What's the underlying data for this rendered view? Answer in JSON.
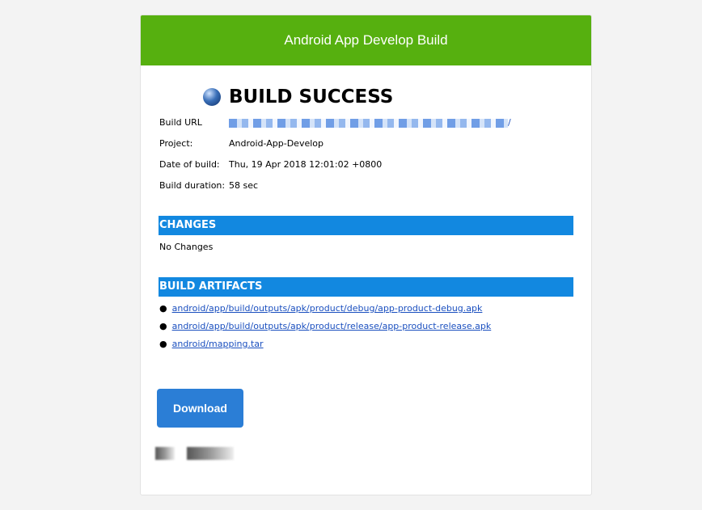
{
  "header": {
    "title": "Android App Develop Build"
  },
  "status": {
    "title": "BUILD SUCCESS",
    "icon": "blue-ball-icon"
  },
  "details": [
    {
      "label": "Build URL",
      "value": "",
      "link_suffix": "/"
    },
    {
      "label": "Project:",
      "value": "Android-App-Develop"
    },
    {
      "label": "Date of build:",
      "value": "Thu, 19 Apr 2018 12:01:02 +0800"
    },
    {
      "label": "Build duration:",
      "value": "58 sec"
    }
  ],
  "changes": {
    "heading": "CHANGES",
    "text": "No Changes"
  },
  "artifacts": {
    "heading": "BUILD ARTIFACTS",
    "items": [
      "android/app/build/outputs/apk/product/debug/app-product-debug.apk",
      "android/app/build/outputs/apk/product/release/app-product-release.apk",
      "android/mapping.tar"
    ]
  },
  "download_label": "Download",
  "colors": {
    "header": "#56b00f",
    "section": "#1288e0",
    "button": "#2b7ed6"
  }
}
